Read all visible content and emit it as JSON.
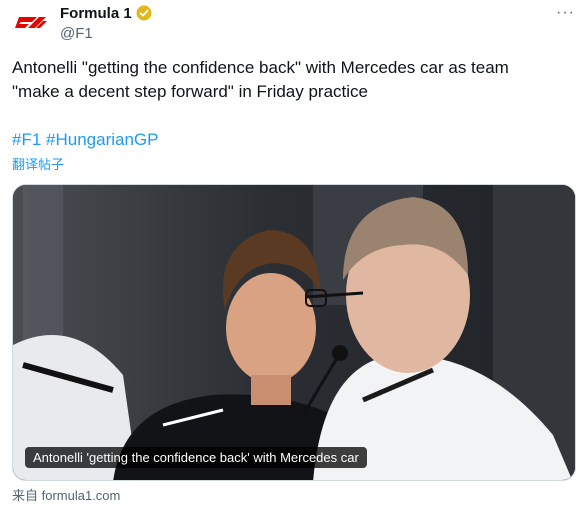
{
  "account": {
    "name": "Formula 1",
    "handle": "@F1",
    "avatar_icon": "f1-logo-icon",
    "verified_icon": "gold-verified-badge-icon",
    "brand_color": "#e10600"
  },
  "tweet": {
    "text": "Antonelli \"getting the confidence back\" with Mercedes car as team \"make a decent step forward\" in Friday practice",
    "hashtags": [
      "#F1",
      "#HungarianGP"
    ],
    "translate_label": "翻译帖子"
  },
  "media": {
    "caption": "Antonelli 'getting the confidence back' with Mercedes car",
    "source_label": "来自 formula1.com"
  },
  "more_icon": "more-options-icon",
  "colors": {
    "link": "#1d9bf0",
    "secondary_text": "#536471"
  }
}
